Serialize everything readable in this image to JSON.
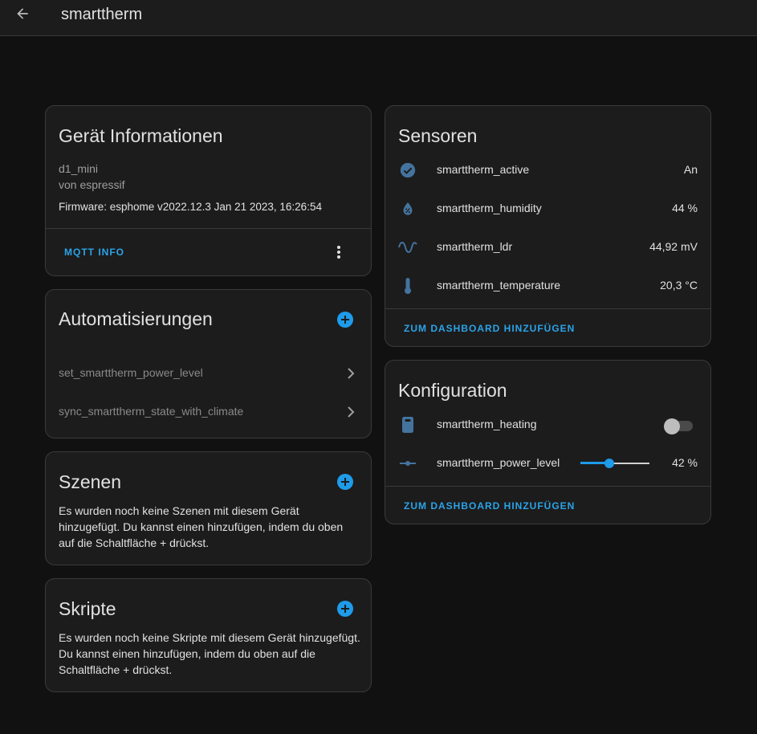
{
  "topbar": {
    "title": "smarttherm",
    "back_icon": "arrow-left-icon"
  },
  "device_info": {
    "title": "Gerät Informationen",
    "model": "d1_mini",
    "manufacturer": "von espressif",
    "firmware": "Firmware: esphome v2022.12.3 Jan 21 2023, 16:26:54",
    "mqtt_button": "MQTT INFO"
  },
  "automations": {
    "title": "Automatisierungen",
    "items": [
      {
        "label": "set_smarttherm_power_level"
      },
      {
        "label": "sync_smarttherm_state_with_climate"
      }
    ]
  },
  "scenes": {
    "title": "Szenen",
    "empty_text": "Es wurden noch keine Szenen mit diesem Gerät hinzugefügt. Du kannst einen hinzufügen, indem du oben auf die Schaltfläche + drückst."
  },
  "scripts": {
    "title": "Skripte",
    "empty_text": "Es wurden noch keine Skripte mit diesem Gerät hinzugefügt. Du kannst einen hinzufügen, indem du oben auf die Schaltfläche + drückst."
  },
  "sensors": {
    "title": "Sensoren",
    "items": [
      {
        "name": "smarttherm_active",
        "value": "An",
        "icon": "check-circle-icon"
      },
      {
        "name": "smarttherm_humidity",
        "value": "44 %",
        "icon": "water-percent-icon"
      },
      {
        "name": "smarttherm_ldr",
        "value": "44,92 mV",
        "icon": "sine-wave-icon"
      },
      {
        "name": "smarttherm_temperature",
        "value": "20,3 °C",
        "icon": "thermometer-icon"
      }
    ],
    "add_button": "ZUM DASHBOARD HINZUFÜGEN"
  },
  "configuration": {
    "title": "Konfiguration",
    "heating": {
      "name": "smarttherm_heating",
      "icon": "thermostat-box-icon",
      "on": false
    },
    "power_level": {
      "name": "smarttherm_power_level",
      "value": "42 %",
      "icon": "slider-icon",
      "level": 0.42
    },
    "add_button": "ZUM DASHBOARD HINZUFÜGEN"
  },
  "colors": {
    "accent": "#1e9be9",
    "icon_blue": "#44739e",
    "card": "#1c1c1c",
    "background": "#111111"
  }
}
